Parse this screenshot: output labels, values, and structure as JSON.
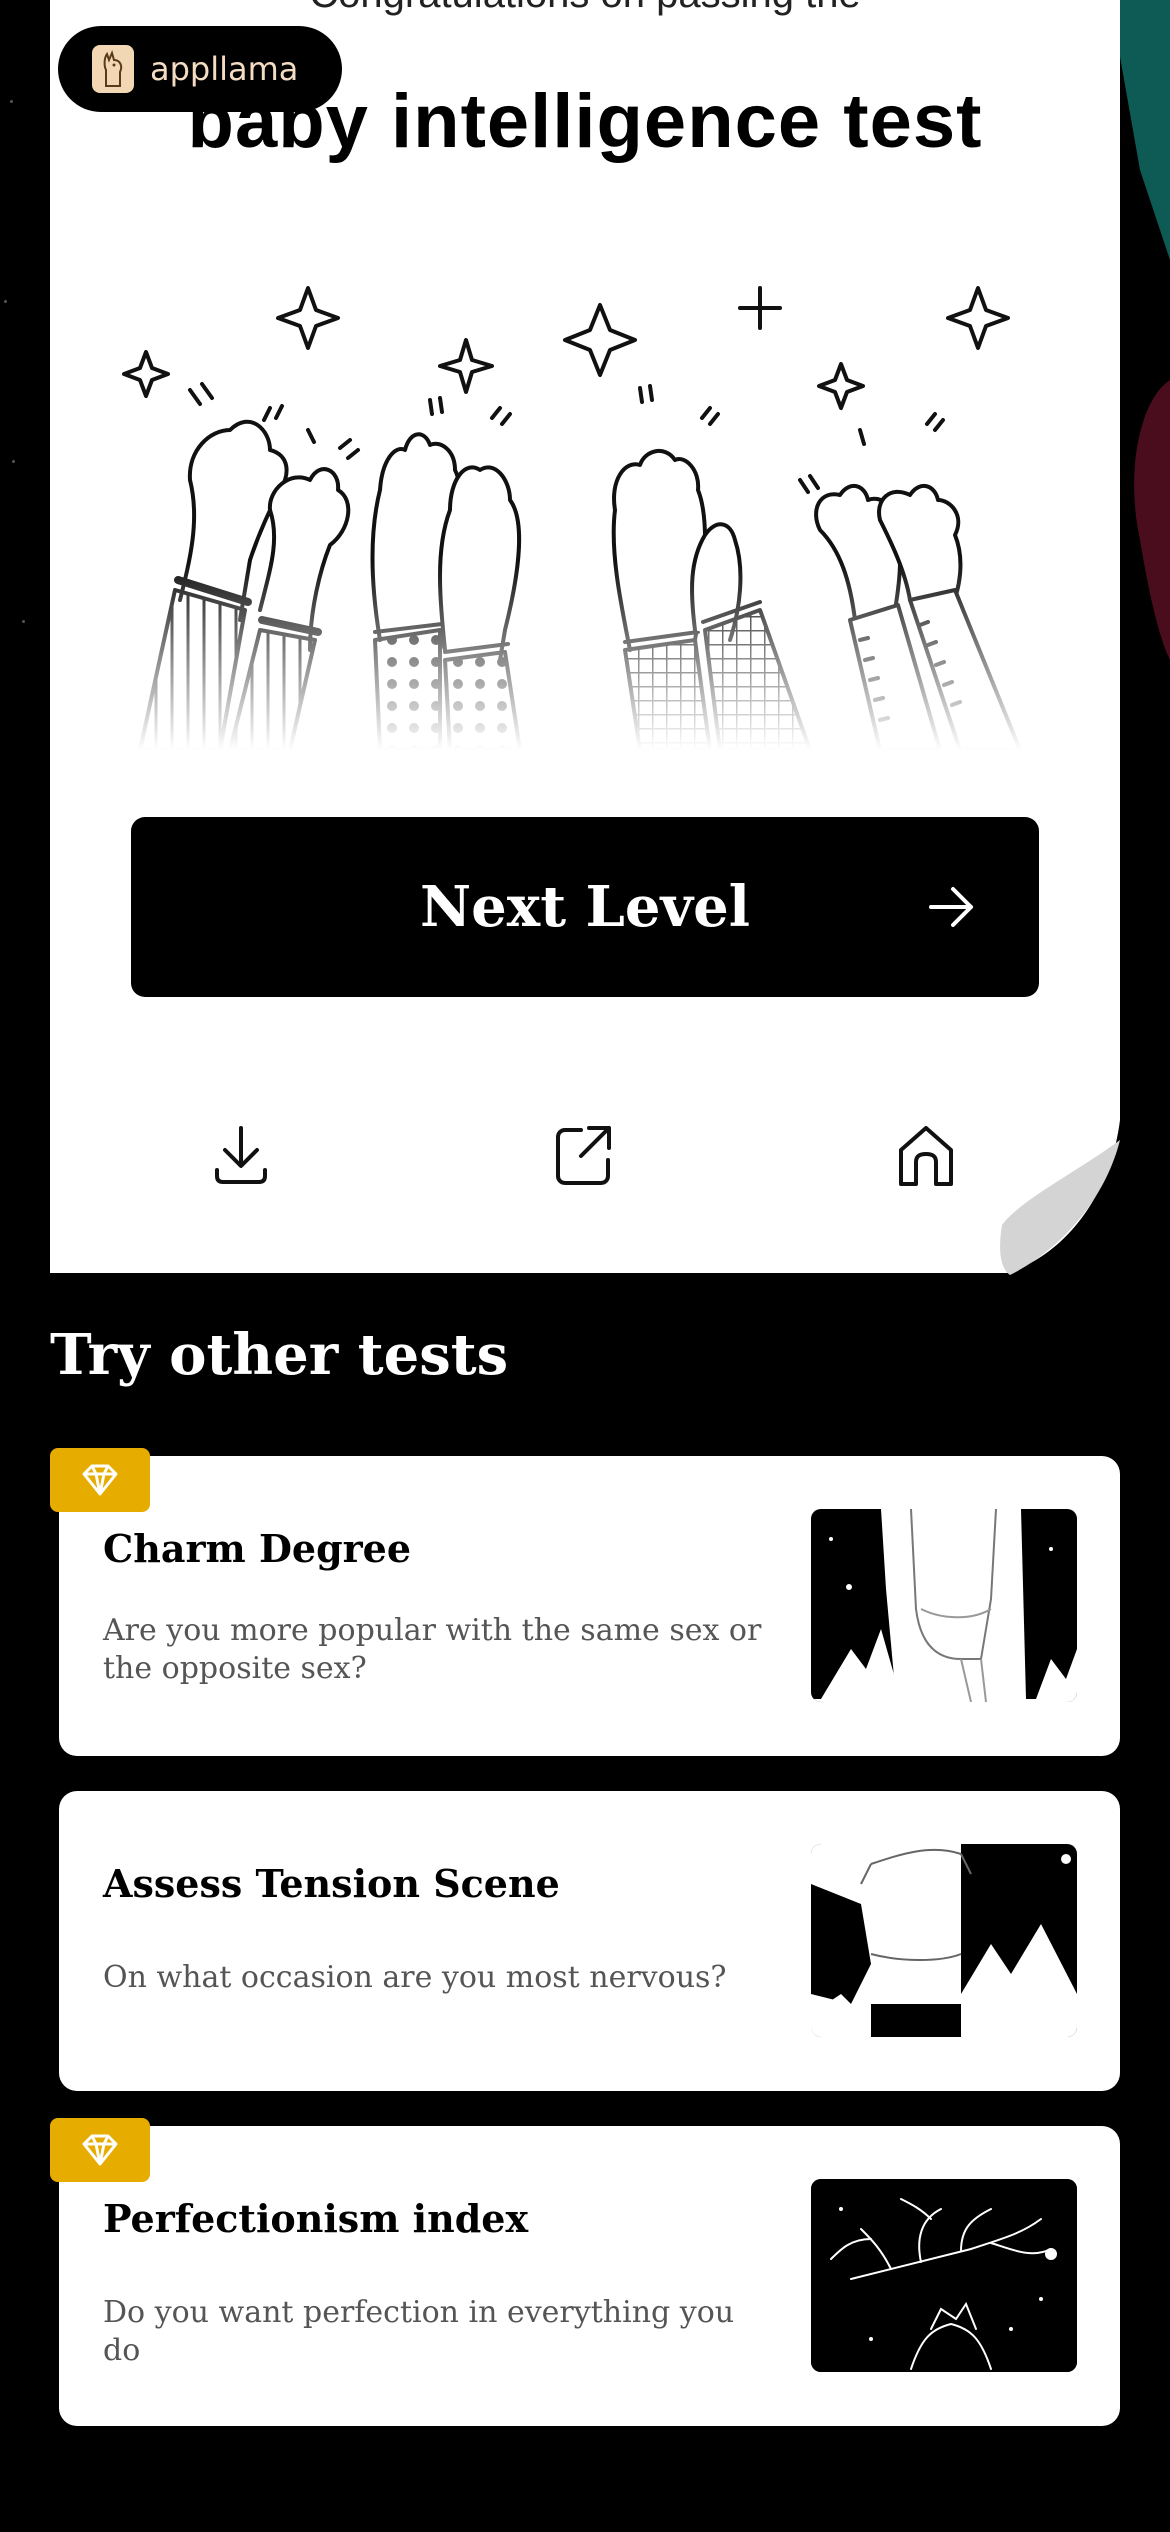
{
  "header": {
    "subtitle": "Congratulations on passing the",
    "title": "baby intelligence test"
  },
  "logo": {
    "text": "appllama",
    "icon": "llama-icon"
  },
  "next_button": {
    "label": "Next Level",
    "icon": "arrow-right-icon"
  },
  "actions": [
    {
      "name": "download",
      "icon": "download-icon"
    },
    {
      "name": "share",
      "icon": "share-icon"
    },
    {
      "name": "home",
      "icon": "home-icon"
    }
  ],
  "other_tests": {
    "title": "Try other tests",
    "items": [
      {
        "name": "Charm Degree",
        "description": "Are you more popular with the same sex or the opposite sex?",
        "premium": true
      },
      {
        "name": "Assess Tension Scene",
        "description": "On what occasion are you most nervous?",
        "premium": false
      },
      {
        "name": "Perfectionism index",
        "description": "Do you want perfection in everything you do",
        "premium": true
      }
    ]
  },
  "colors": {
    "badge": "#e6ac00",
    "background": "#000000",
    "card": "#ffffff"
  }
}
